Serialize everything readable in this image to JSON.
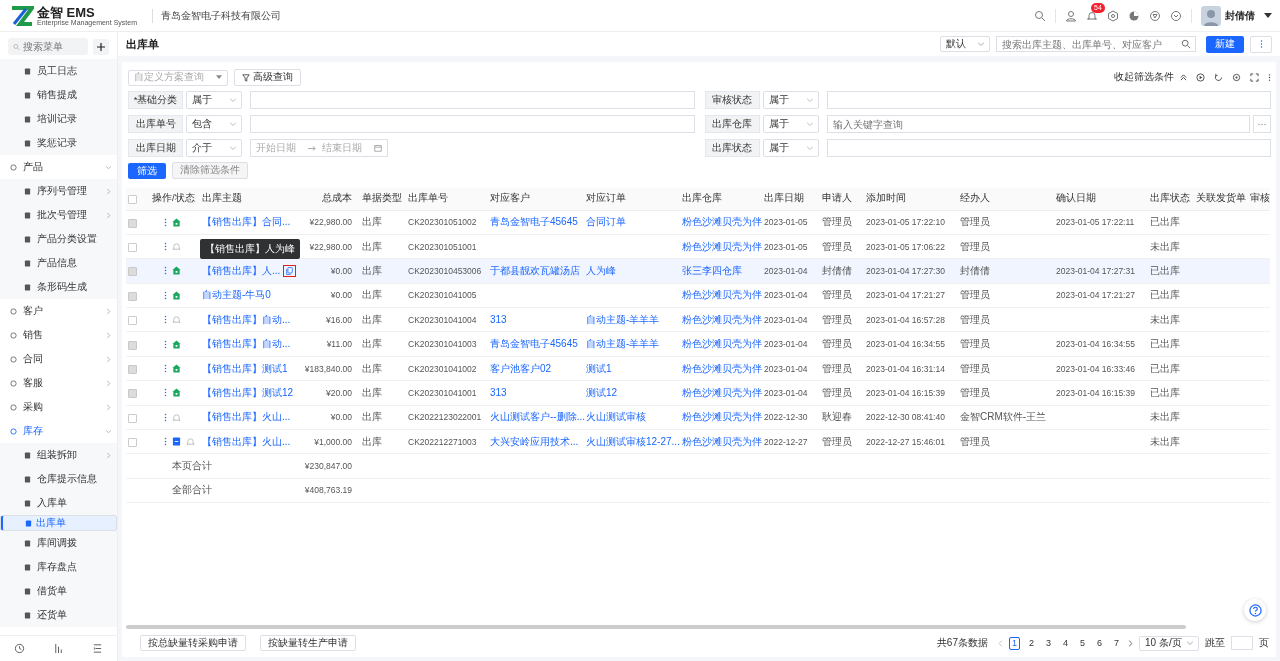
{
  "header": {
    "logo_text": "金智 EMS",
    "logo_subtitle": "Enterprise Management System",
    "company": "青岛金智电子科技有限公司",
    "notifications": "54",
    "user_name": "封倩倩"
  },
  "sidebar": {
    "search": {
      "placeholder": "搜索菜单"
    },
    "items_above": [
      {
        "label": "员工日志"
      },
      {
        "label": "销售提成"
      },
      {
        "label": "培训记录"
      },
      {
        "label": "奖惩记录"
      }
    ],
    "groups": [
      {
        "label": "产品",
        "expanded": true,
        "active": false,
        "children": [
          {
            "label": "序列号管理",
            "has_submenu": true,
            "selected": false
          },
          {
            "label": "批次号管理",
            "has_submenu": true,
            "selected": false
          },
          {
            "label": "产品分类设置",
            "has_submenu": false,
            "selected": false
          },
          {
            "label": "产品信息",
            "has_submenu": false,
            "selected": false
          },
          {
            "label": "条形码生成",
            "has_submenu": false,
            "selected": false
          }
        ]
      },
      {
        "label": "客户",
        "expanded": false,
        "active": false
      },
      {
        "label": "销售",
        "expanded": false,
        "active": false
      },
      {
        "label": "合同",
        "expanded": false,
        "active": false
      },
      {
        "label": "客服",
        "expanded": false,
        "active": false
      },
      {
        "label": "采购",
        "expanded": false,
        "active": false
      },
      {
        "label": "库存",
        "expanded": true,
        "active": true,
        "children": [
          {
            "label": "组装拆卸",
            "has_submenu": true,
            "selected": false
          },
          {
            "label": "仓库提示信息",
            "has_submenu": false,
            "selected": false
          },
          {
            "label": "入库单",
            "has_submenu": false,
            "selected": false
          },
          {
            "label": "出库单",
            "has_submenu": false,
            "selected": true
          },
          {
            "label": "库间调拨",
            "has_submenu": false,
            "selected": false
          },
          {
            "label": "库存盘点",
            "has_submenu": false,
            "selected": false
          },
          {
            "label": "借货单",
            "has_submenu": false,
            "selected": false
          },
          {
            "label": "还货单",
            "has_submenu": false,
            "selected": false
          }
        ]
      }
    ]
  },
  "page": {
    "title": "出库单",
    "view_select": "默认",
    "search": {
      "placeholder": "搜索出库主题、出库单号、对应客户"
    },
    "new_button": "新建"
  },
  "filters": {
    "scheme": {
      "placeholder": "自定义方案查询"
    },
    "advanced_button": "高级查询",
    "collapse_link": "收起筛选条件",
    "left": [
      {
        "label": "*基础分类",
        "operator": "属于",
        "kind": "text"
      },
      {
        "label": "出库单号",
        "operator": "包含",
        "kind": "text"
      },
      {
        "label": "出库日期",
        "operator": "介于",
        "kind": "daterange",
        "start_placeholder": "开始日期",
        "end_placeholder": "结束日期"
      }
    ],
    "right": [
      {
        "label": "审核状态",
        "operator": "属于",
        "kind": "text"
      },
      {
        "label": "出库仓库",
        "operator": "属于",
        "kind": "lookup",
        "placeholder": "输入关键字查询"
      },
      {
        "label": "出库状态",
        "operator": "属于",
        "kind": "text"
      }
    ],
    "apply_button": "筛选",
    "clear_button": {
      "label": "清除筛选条件",
      "disabled": true
    }
  },
  "table": {
    "select_all_checked": false,
    "columns": [
      "操作/状态",
      "出库主题",
      "总成本",
      "单据类型",
      "出库单号",
      "对应客户",
      "对应订单",
      "出库仓库",
      "出库日期",
      "申请人",
      "添加时间",
      "经办人",
      "确认日期",
      "出库状态",
      "关联发货单",
      "审核"
    ],
    "rows": [
      {
        "shipped": true,
        "attachment": false,
        "highlighted": false,
        "subject": "【销售出库】合同...",
        "cost": "¥22,980.00",
        "type": "出库",
        "number": "CK202301051002",
        "customer": "青岛金智电子45645",
        "order": "合同订单",
        "warehouse": "粉色沙滩贝壳为伴",
        "date": "2023-01-05",
        "applicant": "管理员",
        "added": "2023-01-05 17:22:10",
        "handler": "管理员",
        "confirmed": "2023-01-05 17:22:11",
        "state": "已出库"
      },
      {
        "shipped": false,
        "attachment": false,
        "highlighted": false,
        "cost": "¥22,980.00",
        "type": "出库",
        "number": "CK202301051001",
        "warehouse": "粉色沙滩贝壳为伴",
        "date": "2023-01-05",
        "applicant": "管理员",
        "added": "2023-01-05 17:06:22",
        "handler": "管理员",
        "state": "未出库"
      },
      {
        "shipped": true,
        "attachment": false,
        "highlighted": true,
        "subject": "【销售出库】人...",
        "cost": "¥0.00",
        "type": "出库",
        "number": "CK2023010453006",
        "customer": "于都县靓欢瓦罐汤店",
        "order": "人为峰",
        "warehouse": "张三李四仓库",
        "date": "2023-01-04",
        "applicant": "封倩倩",
        "added": "2023-01-04 17:27:30",
        "handler": "封倩倩",
        "confirmed": "2023-01-04 17:27:31",
        "state": "已出库"
      },
      {
        "shipped": true,
        "attachment": false,
        "highlighted": false,
        "subject": "自动主题-牛马0",
        "cost": "¥0.00",
        "type": "出库",
        "number": "CK202301041005",
        "warehouse": "粉色沙滩贝壳为伴",
        "date": "2023-01-04",
        "applicant": "管理员",
        "added": "2023-01-04 17:21:27",
        "handler": "管理员",
        "confirmed": "2023-01-04 17:21:27",
        "state": "已出库"
      },
      {
        "shipped": false,
        "attachment": false,
        "highlighted": false,
        "subject": "【销售出库】自动...",
        "cost": "¥16.00",
        "type": "出库",
        "number": "CK202301041004",
        "customer": "313",
        "order": "自动主题-羊羊羊",
        "warehouse": "粉色沙滩贝壳为伴",
        "date": "2023-01-04",
        "applicant": "管理员",
        "added": "2023-01-04 16:57:28",
        "handler": "管理员",
        "state": "未出库"
      },
      {
        "shipped": true,
        "attachment": false,
        "highlighted": false,
        "subject": "【销售出库】自动...",
        "cost": "¥11.00",
        "type": "出库",
        "number": "CK202301041003",
        "customer": "青岛金智电子45645",
        "order": "自动主题-羊羊羊",
        "warehouse": "粉色沙滩贝壳为伴",
        "date": "2023-01-04",
        "applicant": "管理员",
        "added": "2023-01-04 16:34:55",
        "handler": "管理员",
        "confirmed": "2023-01-04 16:34:55",
        "state": "已出库"
      },
      {
        "shipped": true,
        "attachment": false,
        "highlighted": false,
        "subject": "【销售出库】测试1",
        "cost": "¥183,840.00",
        "type": "出库",
        "number": "CK202301041002",
        "customer": "客户池客户02",
        "order": "测试1",
        "warehouse": "粉色沙滩贝壳为伴",
        "date": "2023-01-04",
        "applicant": "管理员",
        "added": "2023-01-04 16:31:14",
        "handler": "管理员",
        "confirmed": "2023-01-04 16:33:46",
        "state": "已出库"
      },
      {
        "shipped": true,
        "attachment": false,
        "highlighted": false,
        "subject": "【销售出库】测试12",
        "cost": "¥20.00",
        "type": "出库",
        "number": "CK202301041001",
        "customer": "313",
        "order": "测试12",
        "warehouse": "粉色沙滩贝壳为伴",
        "date": "2023-01-04",
        "applicant": "管理员",
        "added": "2023-01-04 16:15:39",
        "handler": "管理员",
        "confirmed": "2023-01-04 16:15:39",
        "state": "已出库"
      },
      {
        "shipped": false,
        "attachment": false,
        "highlighted": false,
        "subject": "【销售出库】火山...",
        "cost": "¥0.00",
        "type": "出库",
        "number": "CK2022123022001",
        "customer": "火山测试客户--删除...",
        "order": "火山测试审核",
        "warehouse": "粉色沙滩贝壳为伴",
        "date": "2022-12-30",
        "applicant": "耿迎春",
        "added": "2022-12-30 08:41:40",
        "handler": "金智CRM软件-王兰",
        "state": "未出库"
      },
      {
        "shipped": false,
        "attachment": true,
        "highlighted": false,
        "subject": "【销售出库】火山...",
        "cost": "¥1,000.00",
        "type": "出库",
        "number": "CK202212271003",
        "customer": "大兴安岭应用技术...",
        "order": "火山测试审核12-27...",
        "warehouse": "粉色沙滩贝壳为伴",
        "date": "2022-12-27",
        "applicant": "管理员",
        "added": "2022-12-27 15:46:01",
        "handler": "管理员",
        "state": "未出库"
      }
    ],
    "summary": [
      {
        "label": "本页合计",
        "cost": "¥230,847.00"
      },
      {
        "label": "全部合计",
        "cost": "¥408,763.19"
      }
    ],
    "tooltip": {
      "text": "【销售出库】人为峰"
    }
  },
  "footer": {
    "buttons": [
      "按总缺量转采购申请",
      "按缺量转生产申请"
    ],
    "total": "共67条数据",
    "pages": [
      {
        "label": "1",
        "selected": true
      },
      {
        "label": "2",
        "selected": false
      },
      {
        "label": "3",
        "selected": false
      },
      {
        "label": "4",
        "selected": false
      },
      {
        "label": "5",
        "selected": false
      },
      {
        "label": "6",
        "selected": false
      },
      {
        "label": "7",
        "selected": false
      }
    ],
    "page_size": "10 条/页",
    "jump_label": "跳至",
    "jump_suffix": "页"
  }
}
